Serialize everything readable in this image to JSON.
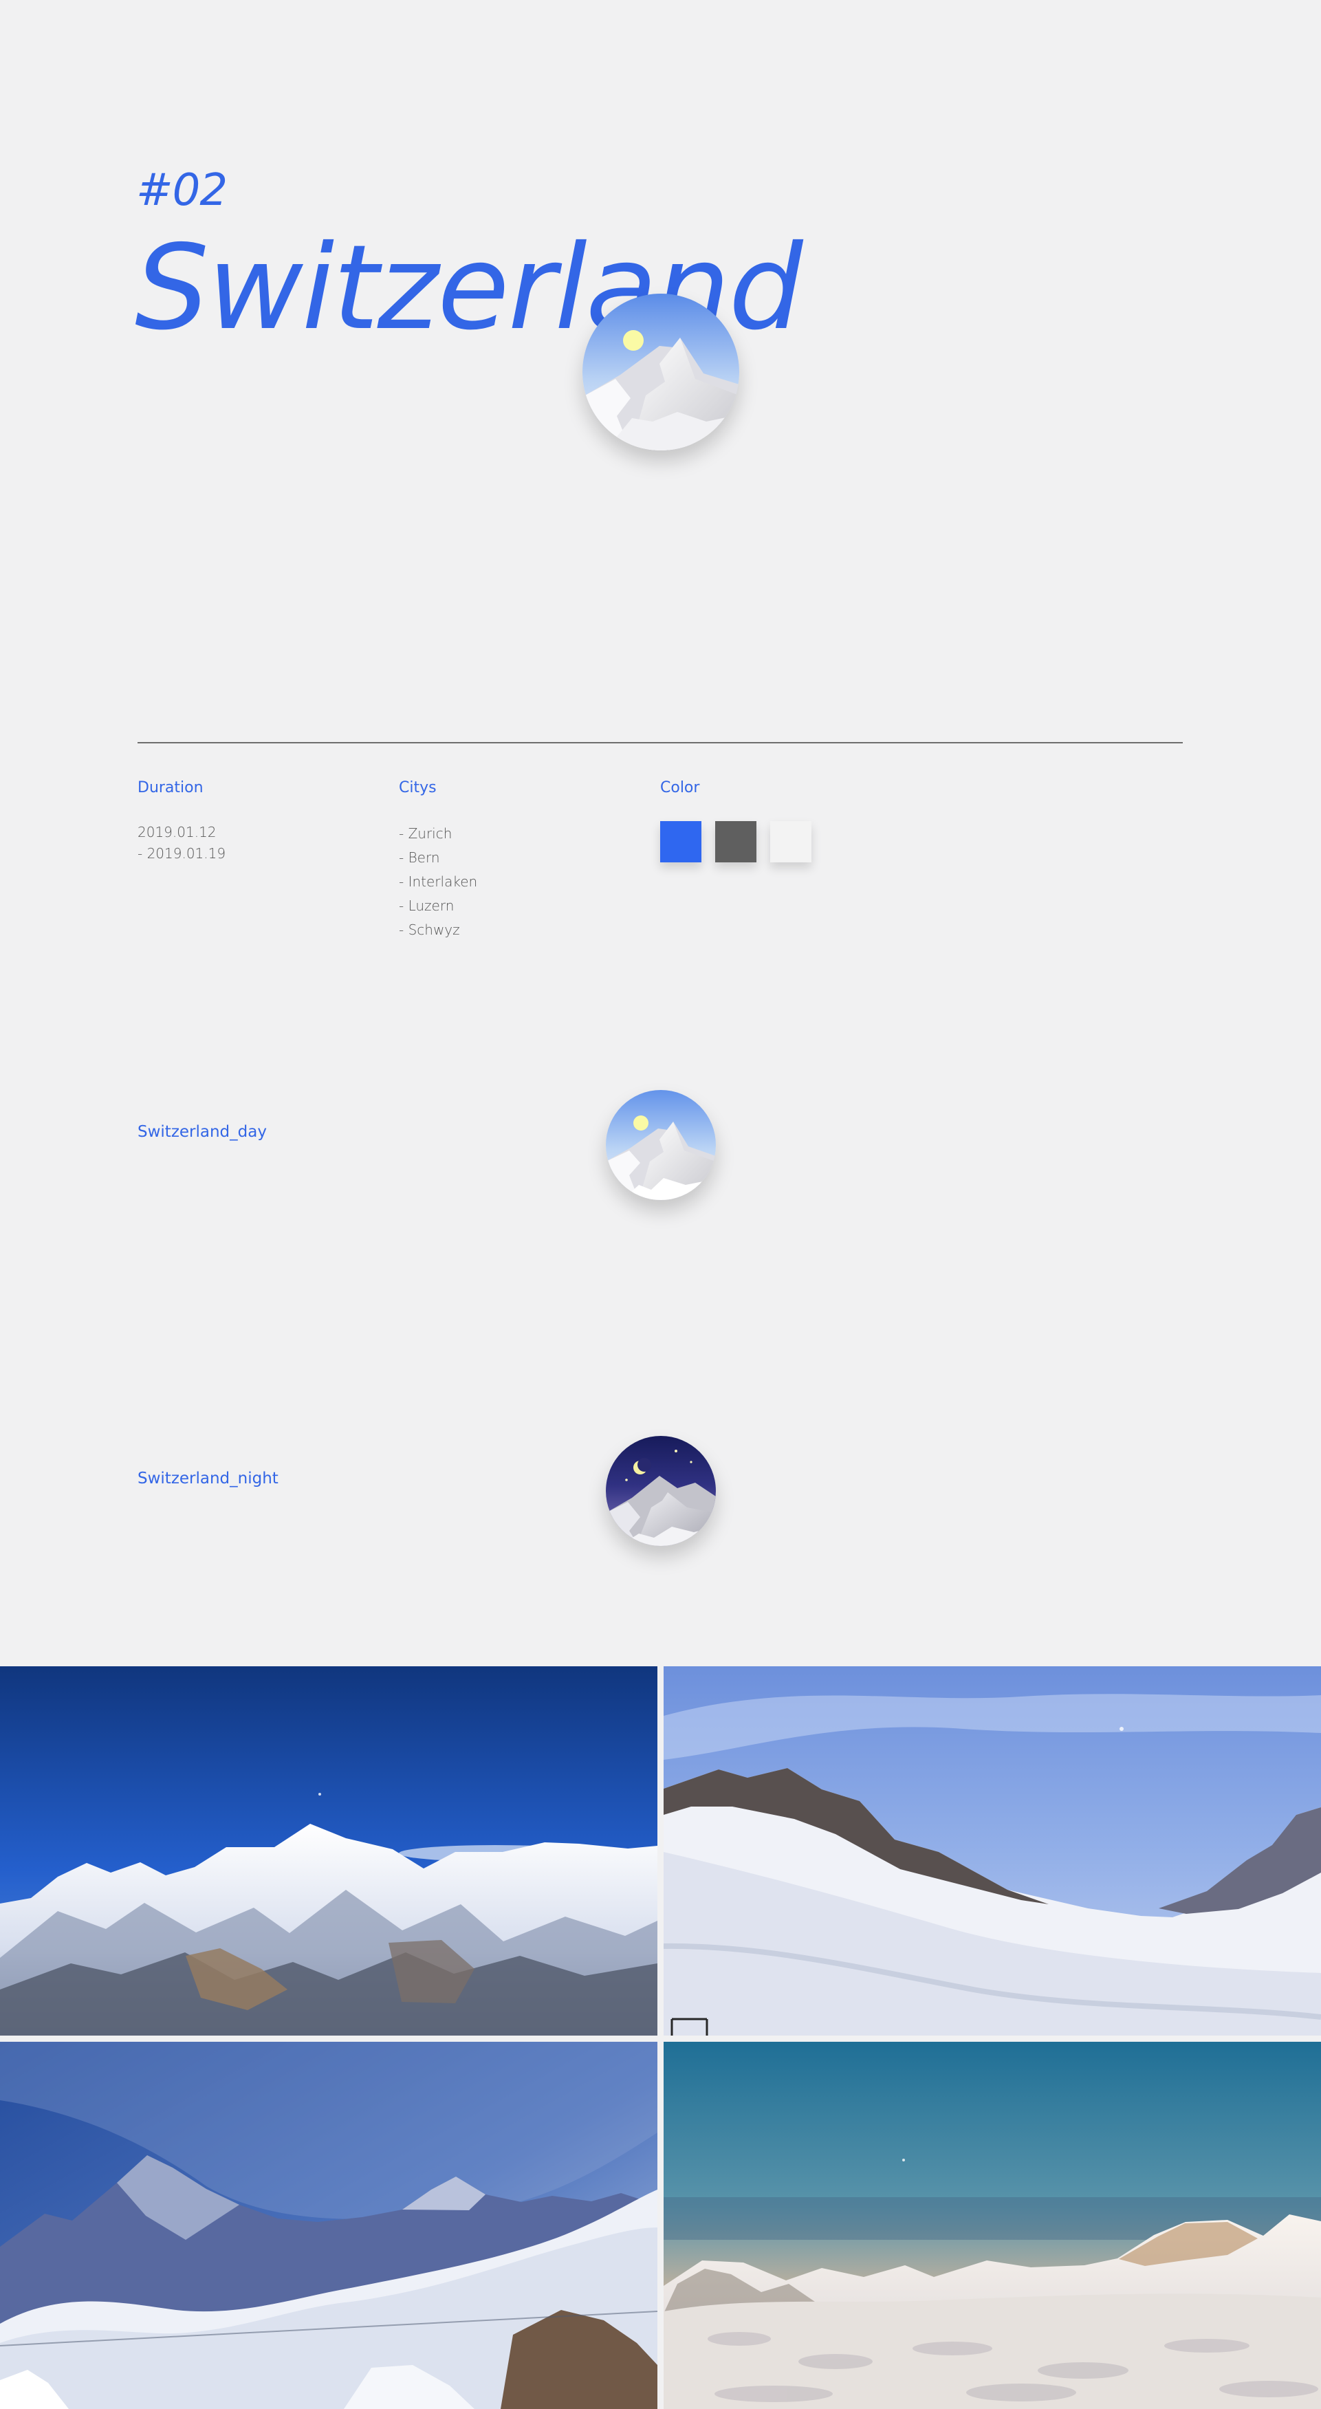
{
  "header": {
    "number": "#02",
    "title": "Switzerland"
  },
  "details": {
    "duration_label": "Duration",
    "duration_values": [
      "2019.01.12",
      "- 2019.01.19"
    ],
    "citys_label": "Citys",
    "cities": [
      "- Zurich",
      "- Bern",
      "- Interlaken",
      "- Luzern",
      "- Schwyz"
    ],
    "color_label": "Color",
    "colors": [
      "#2f67f0",
      "#5f5f5f",
      "#f3f3f3"
    ]
  },
  "variants": {
    "day_label": "Switzerland_day",
    "night_label": "Switzerland_night"
  },
  "icons": {
    "large": "mountain-day-icon",
    "day": "mountain-day-icon",
    "night": "mountain-night-icon"
  },
  "photos": [
    "snowy-mountain-range-photo",
    "ski-slope-photo",
    "cloudy-mountain-peaks-photo",
    "sunset-snowfield-photo"
  ],
  "accent_color": "#3366e6",
  "background_color": "#f1f1f2"
}
